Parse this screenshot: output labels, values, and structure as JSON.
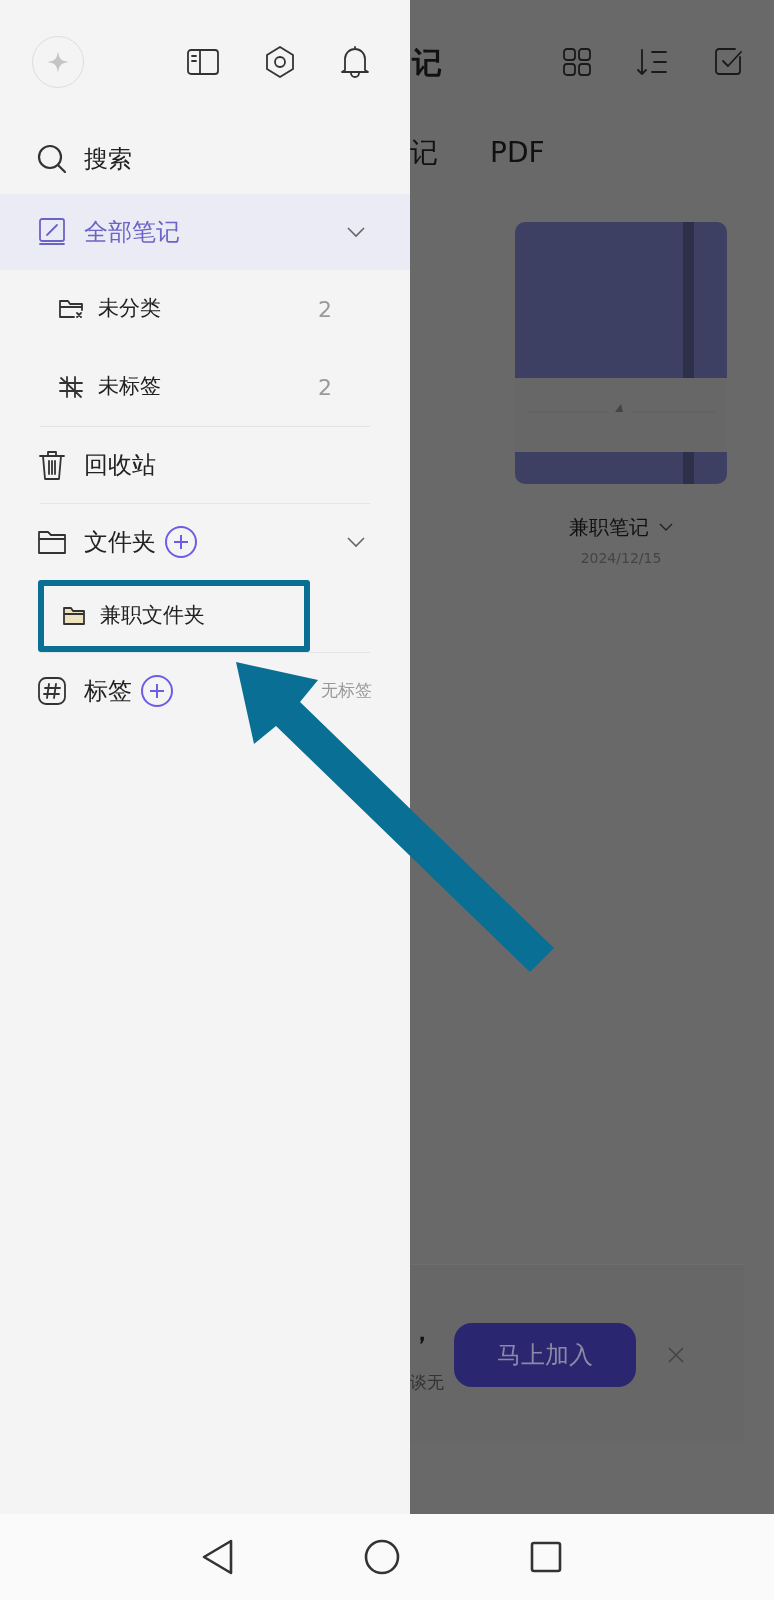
{
  "sidebar": {
    "search": {
      "label": "搜索"
    },
    "items": [
      {
        "kind": "notes",
        "label": "全部笔记",
        "selected": true,
        "expanded": true,
        "children": [
          {
            "label": "未分类",
            "count": "2"
          },
          {
            "label": "未标签",
            "count": "2"
          }
        ]
      },
      {
        "kind": "trash",
        "label": "回收站",
        "selected": false
      },
      {
        "kind": "folders",
        "label": "文件夹",
        "selected": false,
        "expanded": true,
        "children": [
          {
            "label": "兼职文件夹",
            "highlighted": true
          }
        ]
      },
      {
        "kind": "tags",
        "label": "标签",
        "selected": false,
        "note": "无标签"
      }
    ]
  },
  "main": {
    "title": "记",
    "tabs": [
      {
        "label": "记"
      },
      {
        "label": "PDF"
      }
    ],
    "notebook": {
      "name": "兼职笔记",
      "date": "2024/12/15"
    },
    "banner": {
      "line_1": "，",
      "line_2": "谈无",
      "button": "马上加入"
    }
  }
}
